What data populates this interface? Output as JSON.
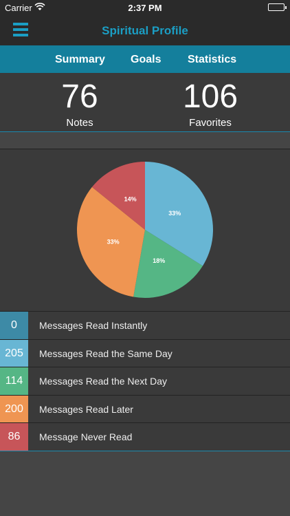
{
  "status_bar": {
    "carrier": "Carrier",
    "time": "2:37 PM"
  },
  "nav": {
    "title": "Spiritual Profile",
    "menu_icon": "hamburger-menu-icon"
  },
  "tabs": [
    {
      "label": "Summary"
    },
    {
      "label": "Goals"
    },
    {
      "label": "Statistics",
      "active": true
    }
  ],
  "counters": [
    {
      "value": "76",
      "label": "Notes"
    },
    {
      "value": "106",
      "label": "Favorites"
    }
  ],
  "chart_data": {
    "type": "pie",
    "slices": [
      {
        "label": "Messages Read Instantly",
        "value": 0,
        "pct_label": "",
        "color": "#3d8aa6"
      },
      {
        "label": "Messages Read the Same Day",
        "value": 205,
        "pct_label": "33%",
        "color": "#68b6d4"
      },
      {
        "label": "Messages Read the Next Day",
        "value": 114,
        "pct_label": "18%",
        "color": "#55b685"
      },
      {
        "label": "Messages Read Later",
        "value": 200,
        "pct_label": "33%",
        "color": "#ef9552"
      },
      {
        "label": "Message Never Read",
        "value": 86,
        "pct_label": "14%",
        "color": "#c75559"
      }
    ]
  },
  "legend": [
    {
      "count": "0",
      "label": "Messages Read Instantly",
      "color": "#3d8aa6"
    },
    {
      "count": "205",
      "label": "Messages Read the Same Day",
      "color": "#68b6d4"
    },
    {
      "count": "114",
      "label": "Messages Read the Next Day",
      "color": "#55b685"
    },
    {
      "count": "200",
      "label": "Messages Read Later",
      "color": "#ef9552"
    },
    {
      "count": "86",
      "label": "Message Never Read",
      "color": "#c75559"
    }
  ],
  "colors": {
    "accent": "#1b9ec4",
    "tab_bar": "#147f9c"
  }
}
